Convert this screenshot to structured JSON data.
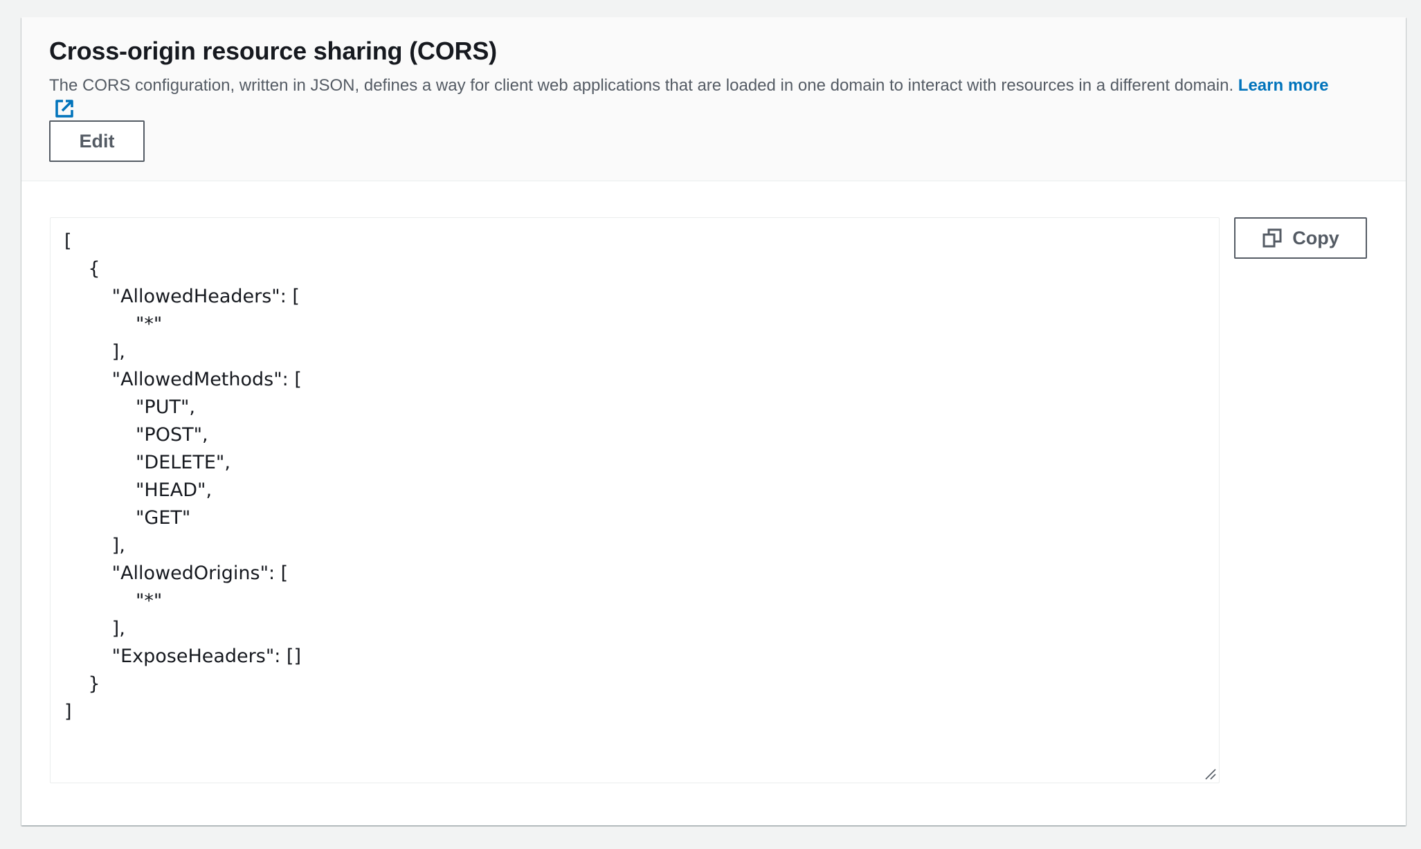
{
  "section": {
    "title": "Cross-origin resource sharing (CORS)",
    "description": "The CORS configuration, written in JSON, defines a way for client web applications that are loaded in one domain to interact with resources in a different domain.",
    "learn_more_label": "Learn more",
    "learn_more_icon": "external-link-icon",
    "edit_label": "Edit"
  },
  "code_editor": {
    "lines": [
      "[",
      "    {",
      "        \"AllowedHeaders\": [",
      "            \"*\"",
      "        ],",
      "        \"AllowedMethods\": [",
      "            \"PUT\",",
      "            \"POST\",",
      "            \"DELETE\",",
      "            \"HEAD\",",
      "            \"GET\"",
      "        ],",
      "        \"AllowedOrigins\": [",
      "            \"*\"",
      "        ],",
      "        \"ExposeHeaders\": []",
      "    }",
      "]"
    ],
    "copy_label": "Copy",
    "copy_icon": "copy-icon"
  },
  "colors": {
    "link": "#0073bb",
    "button_text": "#545b64",
    "page_background": "#f2f3f3",
    "header_background": "#fafafa"
  }
}
